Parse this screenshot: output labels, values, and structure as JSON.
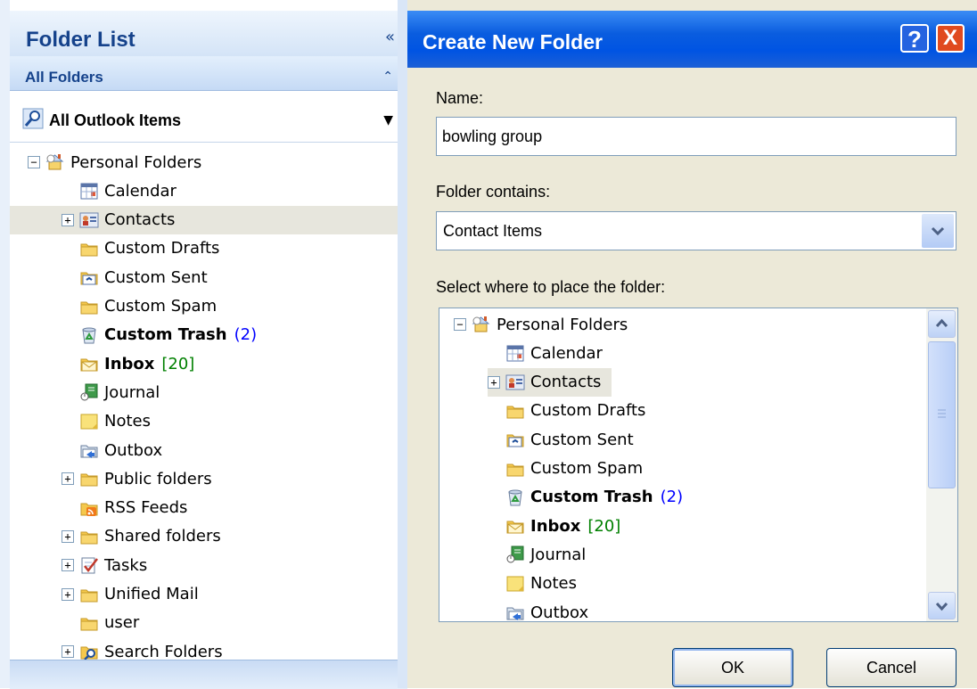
{
  "folder_pane": {
    "title": "Folder List",
    "collapse_glyph": "«",
    "section_label": "All Folders",
    "section_chevron": "⌃",
    "view_selector": "All Outlook Items",
    "view_selector_arrow": "▼",
    "tree": [
      {
        "label": "Personal Folders",
        "expander": "−",
        "icon": "personal-folders-icon"
      },
      {
        "label": "Calendar",
        "icon": "calendar-icon"
      },
      {
        "label": "Contacts",
        "expander": "+",
        "icon": "contacts-icon",
        "selected": true
      },
      {
        "label": "Custom Drafts",
        "icon": "folder-icon"
      },
      {
        "label": "Custom Sent",
        "icon": "sent-folder-icon"
      },
      {
        "label": "Custom Spam",
        "icon": "folder-icon"
      },
      {
        "label": "Custom Trash",
        "icon": "trash-icon",
        "bold": true,
        "count": "(2)"
      },
      {
        "label": "Inbox",
        "icon": "inbox-icon",
        "bold": true,
        "count": "[20]"
      },
      {
        "label": "Journal",
        "icon": "journal-icon"
      },
      {
        "label": "Notes",
        "icon": "notes-icon"
      },
      {
        "label": "Outbox",
        "icon": "outbox-icon"
      },
      {
        "label": "Public folders",
        "expander": "+",
        "icon": "folder-icon"
      },
      {
        "label": "RSS Feeds",
        "icon": "rss-icon"
      },
      {
        "label": "Shared folders",
        "expander": "+",
        "icon": "folder-icon"
      },
      {
        "label": "Tasks",
        "expander": "+",
        "icon": "tasks-icon"
      },
      {
        "label": "Unified Mail",
        "expander": "+",
        "icon": "folder-icon"
      },
      {
        "label": "user",
        "icon": "folder-icon"
      },
      {
        "label": "Search Folders",
        "expander": "+",
        "icon": "search-folder-icon"
      }
    ]
  },
  "dialog": {
    "title": "Create New Folder",
    "help_button": "?",
    "close_button": "X",
    "name_label": "Name:",
    "name_value": "bowling group",
    "contains_label": "Folder contains:",
    "contains_value": "Contact Items",
    "place_label": "Select where to place the folder:",
    "tree": [
      {
        "label": "Personal Folders",
        "expander": "−",
        "icon": "personal-folders-icon"
      },
      {
        "label": "Calendar",
        "icon": "calendar-icon"
      },
      {
        "label": "Contacts",
        "expander": "+",
        "icon": "contacts-icon",
        "selected": true
      },
      {
        "label": "Custom Drafts",
        "icon": "folder-icon"
      },
      {
        "label": "Custom Sent",
        "icon": "sent-folder-icon"
      },
      {
        "label": "Custom Spam",
        "icon": "folder-icon"
      },
      {
        "label": "Custom Trash",
        "icon": "trash-icon",
        "bold": true,
        "count": "(2)"
      },
      {
        "label": "Inbox",
        "icon": "inbox-icon",
        "bold": true,
        "count": "[20]"
      },
      {
        "label": "Journal",
        "icon": "journal-icon"
      },
      {
        "label": "Notes",
        "icon": "notes-icon"
      },
      {
        "label": "Outbox",
        "icon": "outbox-icon"
      }
    ],
    "ok_label": "OK",
    "cancel_label": "Cancel"
  },
  "colors": {
    "pane_header_text": "#15428b",
    "titlebar_blue": "#0054e3",
    "close_red": "#e04a1f",
    "dialog_bg": "#ece9d8",
    "selected_row": "#e7e6dd",
    "count_blue": "#0000ff",
    "count_green": "#008000"
  }
}
